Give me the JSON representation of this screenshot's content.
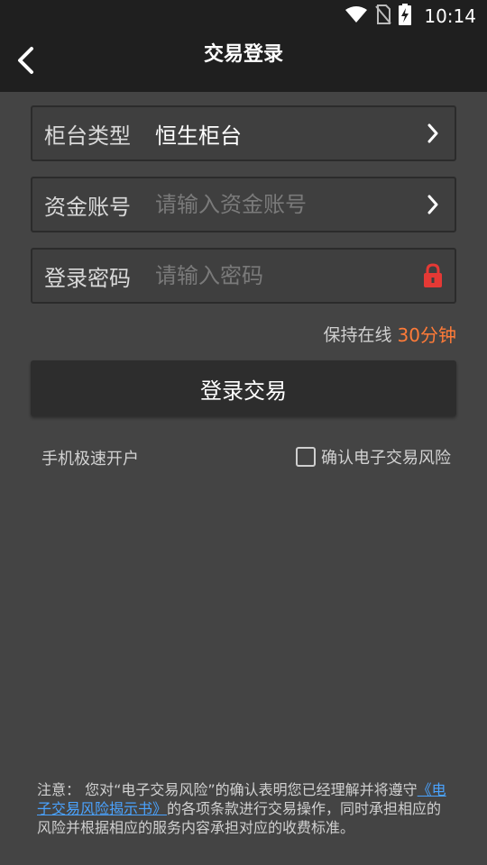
{
  "status": {
    "time": "10:14"
  },
  "appbar": {
    "title": "交易登录"
  },
  "form": {
    "counter_type": {
      "label": "柜台类型",
      "value": "恒生柜台"
    },
    "account": {
      "label": "资金账号",
      "placeholder": "请输入资金账号"
    },
    "password": {
      "label": "登录密码",
      "placeholder": "请输入密码"
    }
  },
  "online": {
    "label": "保持在线",
    "value": "30分钟"
  },
  "login_button": {
    "label": "登录交易"
  },
  "open_account": {
    "label": "手机极速开户"
  },
  "risk_confirm": {
    "label": "确认电子交易风险"
  },
  "notice": {
    "prefix": "注意： 您对“电子交易风险”的确认表明您已经理解并将遵守",
    "link": "《电子交易风险揭示书》",
    "suffix": "的各项条款进行交易操作，同时承担相应的风险并根据相应的服务内容承担对应的收费标准。"
  },
  "colors": {
    "accent": "#ff7b38",
    "link": "#4aa3ff",
    "lock": "#e53935",
    "background": "#444444",
    "bar": "#1f1f1f"
  }
}
